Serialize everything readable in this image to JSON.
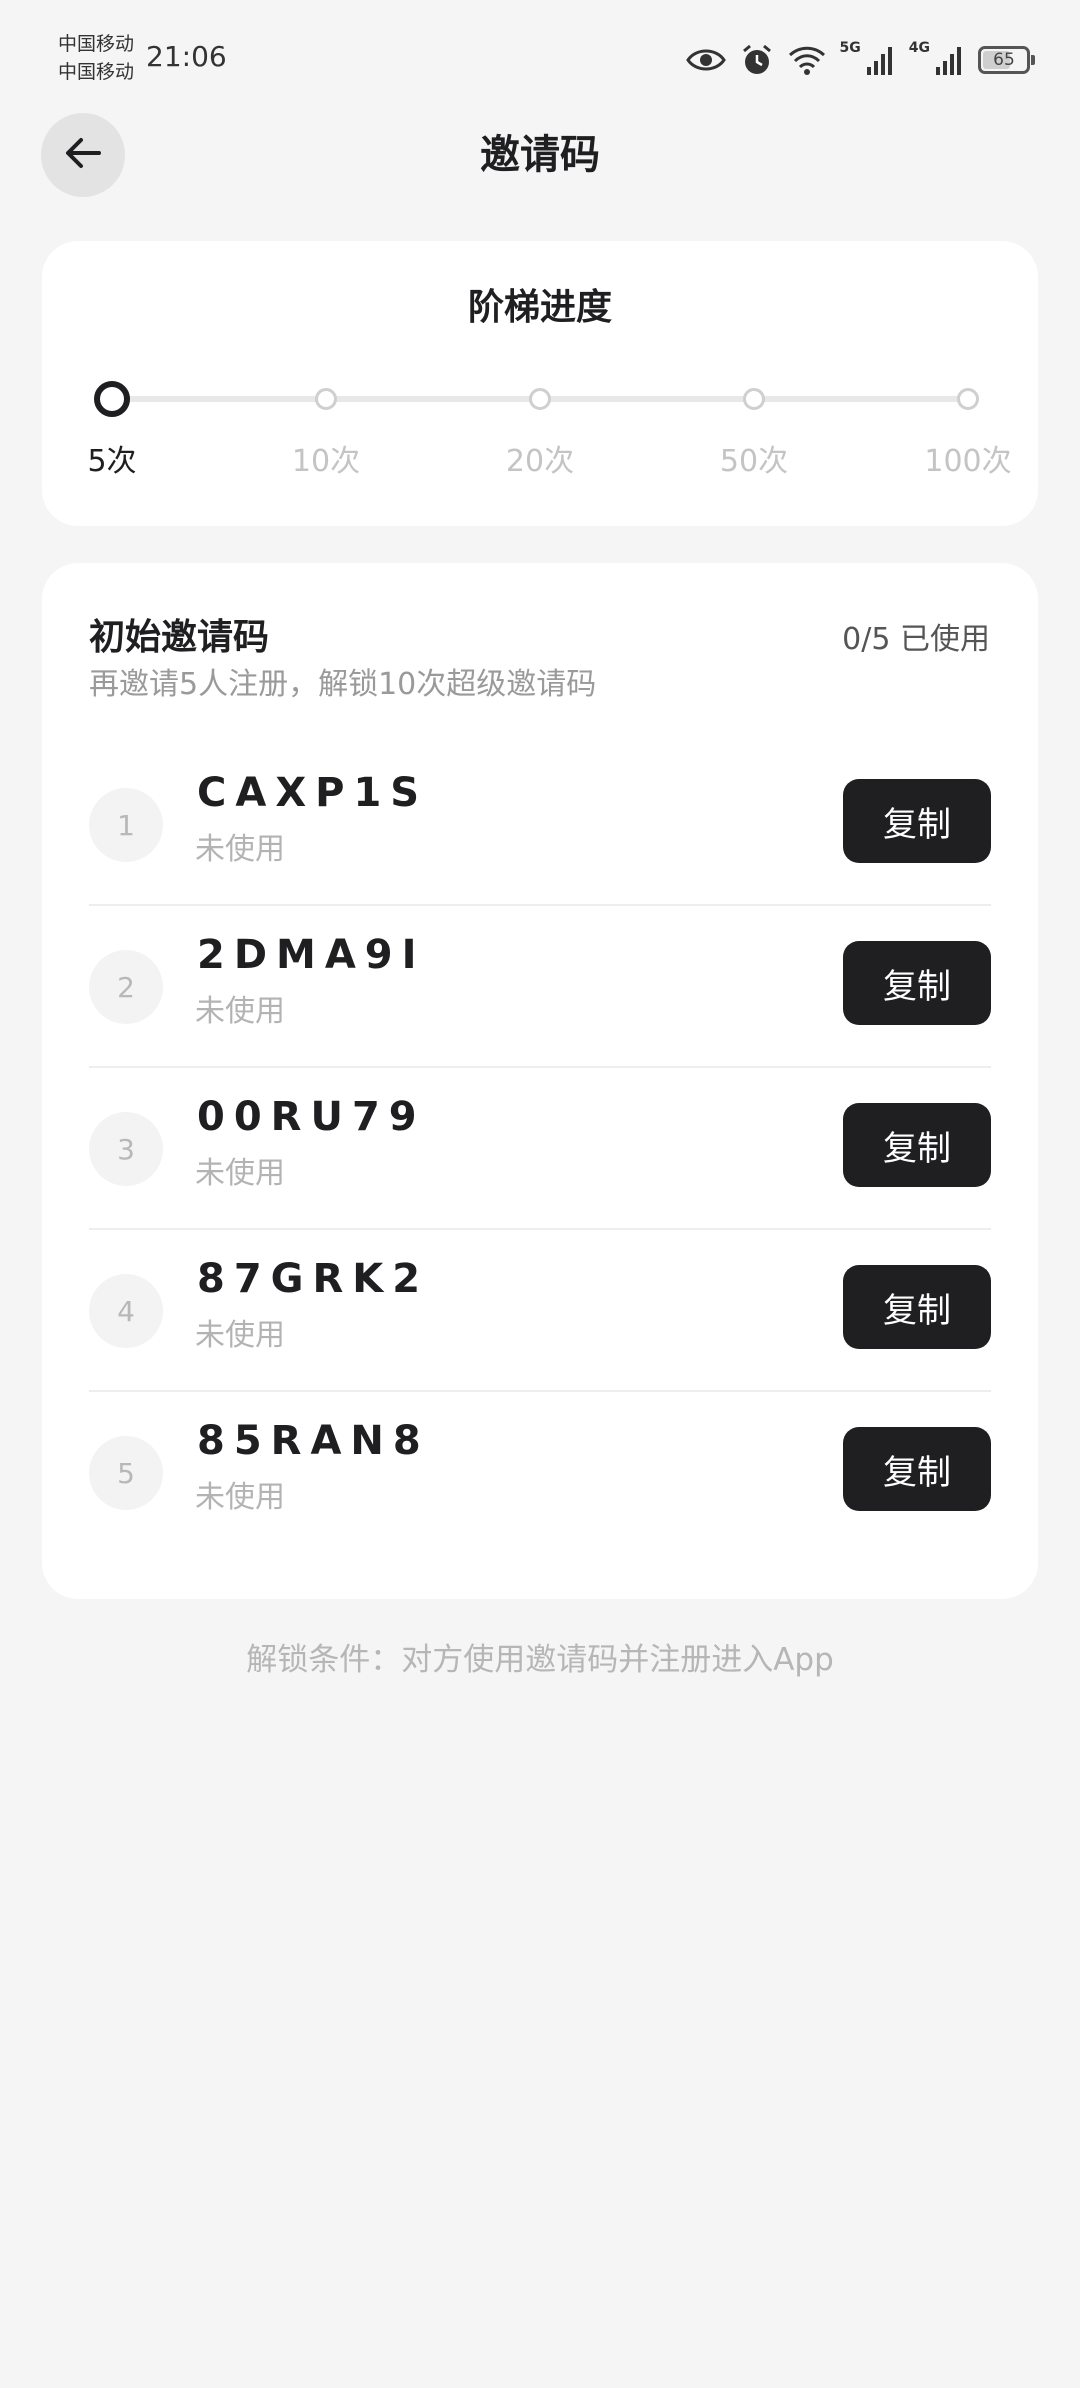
{
  "status_bar": {
    "carrier_1": "中国移动",
    "carrier_2": "中国移动",
    "time": "21:06",
    "net_1": "5G",
    "net_2": "4G",
    "battery": "65",
    "battery_level": 0.65
  },
  "header": {
    "title": "邀请码"
  },
  "progress": {
    "title": "阶梯进度",
    "current_step": 0,
    "steps": [
      {
        "label": "5次",
        "active": true
      },
      {
        "label": "10次",
        "active": false
      },
      {
        "label": "20次",
        "active": false
      },
      {
        "label": "50次",
        "active": false
      },
      {
        "label": "100次",
        "active": false
      }
    ]
  },
  "codes_section": {
    "title": "初始邀请码",
    "usage": "0/5 已使用",
    "hint": "再邀请5人注册，解锁10次超级邀请码",
    "copy_label": "复制",
    "items": [
      {
        "index": "1",
        "code": "CAXP1S",
        "status": "未使用"
      },
      {
        "index": "2",
        "code": "2DMA9I",
        "status": "未使用"
      },
      {
        "index": "3",
        "code": "00RU79",
        "status": "未使用"
      },
      {
        "index": "4",
        "code": "87GRK2",
        "status": "未使用"
      },
      {
        "index": "5",
        "code": "85RAN8",
        "status": "未使用"
      }
    ]
  },
  "footer": {
    "note": "解锁条件：对方使用邀请码并注册进入App"
  },
  "colors": {
    "accent": "#1f1f22",
    "muted": "#b3b3b3",
    "background": "#f5f5f5"
  }
}
